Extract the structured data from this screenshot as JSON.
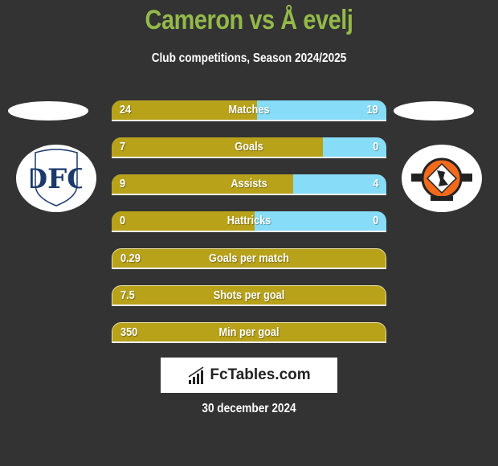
{
  "header": {
    "title": "Cameron vs Å evelj",
    "subtitle": "Club competitions, Season 2024/2025"
  },
  "colors": {
    "title": "#93b94a",
    "left_bar": "#b8a21a",
    "right_bar": "#87dcf7",
    "background": "#333333"
  },
  "teams": {
    "left": {
      "logo_icon": "dundee-fc-crest-icon",
      "logo_text": "DFC"
    },
    "right": {
      "logo_icon": "dundee-united-crest-icon"
    }
  },
  "stats": [
    {
      "label": "Matches",
      "left": "24",
      "right": "19",
      "left_share": 0.53
    },
    {
      "label": "Goals",
      "left": "7",
      "right": "0",
      "left_share": 0.77
    },
    {
      "label": "Assists",
      "left": "9",
      "right": "4",
      "left_share": 0.66
    },
    {
      "label": "Hattricks",
      "left": "0",
      "right": "0",
      "left_share": 0.52
    },
    {
      "label": "Goals per match",
      "left": "0.29",
      "right": "",
      "left_share": 1
    },
    {
      "label": "Shots per goal",
      "left": "7.5",
      "right": "",
      "left_share": 1
    },
    {
      "label": "Min per goal",
      "left": "350",
      "right": "",
      "left_share": 1
    }
  ],
  "footer": {
    "brand": "FcTables.com",
    "date": "30 december 2024"
  }
}
